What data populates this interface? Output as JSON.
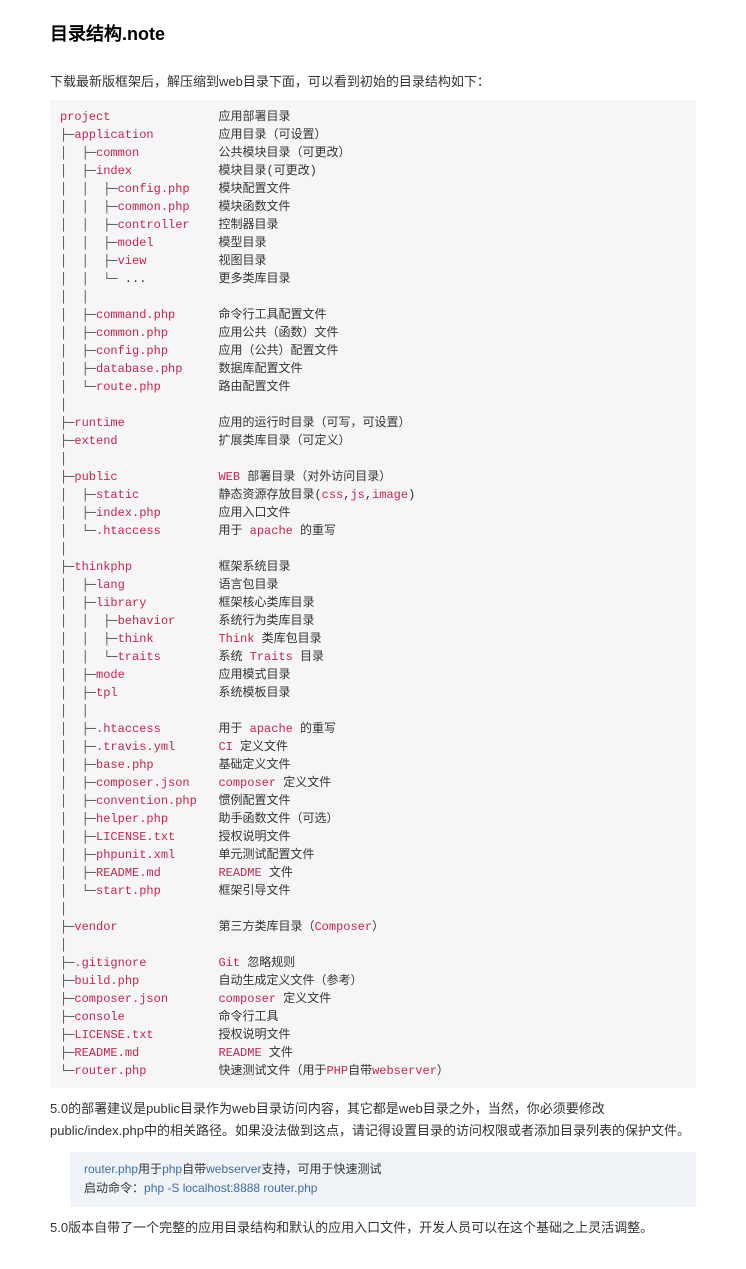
{
  "title": "目录结构.note",
  "intro": "下载最新版框架后，解压缩到web目录下面，可以看到初始的目录结构如下：",
  "tree": [
    {
      "pre": "",
      "name": "project",
      "desc": "应用部署目录",
      "emphName": true,
      "nameWidth": 10
    },
    {
      "pre": "├─",
      "name": "application",
      "desc": "应用目录（可设置）",
      "emphName": true
    },
    {
      "pre": "│  ├─",
      "name": "common",
      "desc": "公共模块目录（可更改）",
      "emphName": true
    },
    {
      "pre": "│  ├─",
      "name": "index",
      "desc": "模块目录(可更改)",
      "emphName": true
    },
    {
      "pre": "│  │  ├─",
      "name": "config.php",
      "desc": "模块配置文件",
      "emphName": true
    },
    {
      "pre": "│  │  ├─",
      "name": "common.php",
      "desc": "模块函数文件",
      "emphName": true
    },
    {
      "pre": "│  │  ├─",
      "name": "controller",
      "desc": "控制器目录",
      "emphName": true
    },
    {
      "pre": "│  │  ├─",
      "name": "model",
      "desc": "模型目录",
      "emphName": true
    },
    {
      "pre": "│  │  ├─",
      "name": "view",
      "desc": "视图目录",
      "emphName": true
    },
    {
      "pre": "│  │  └─",
      "name": " ...",
      "desc": "更多类库目录",
      "emphName": false
    },
    {
      "blank": true,
      "pre": "│  │"
    },
    {
      "pre": "│  ├─",
      "name": "command.php",
      "desc": "命令行工具配置文件",
      "emphName": true
    },
    {
      "pre": "│  ├─",
      "name": "common.php",
      "desc": "应用公共（函数）文件",
      "emphName": true
    },
    {
      "pre": "│  ├─",
      "name": "config.php",
      "desc": "应用（公共）配置文件",
      "emphName": true
    },
    {
      "pre": "│  ├─",
      "name": "database.php",
      "desc": "数据库配置文件",
      "emphName": true
    },
    {
      "pre": "│  └─",
      "name": "route.php",
      "desc": "路由配置文件",
      "emphName": true
    },
    {
      "blank": true,
      "pre": "│"
    },
    {
      "pre": "├─",
      "name": "runtime",
      "desc": "应用的运行时目录（可写，可设置）",
      "emphName": true
    },
    {
      "pre": "├─",
      "name": "extend",
      "desc": "扩展类库目录（可定义）",
      "emphName": true
    },
    {
      "blank": true,
      "pre": "│"
    },
    {
      "pre": "├─",
      "name": "public",
      "descParts": [
        {
          "t": "WEB",
          "e": true
        },
        {
          "t": " 部署目录（对外访问目录）",
          "e": false
        }
      ],
      "emphName": true
    },
    {
      "pre": "│  ├─",
      "name": "static",
      "descParts": [
        {
          "t": "静态资源存放目录(",
          "e": false
        },
        {
          "t": "css",
          "e": true
        },
        {
          "t": ",",
          "e": false
        },
        {
          "t": "js",
          "e": true
        },
        {
          "t": ",",
          "e": false
        },
        {
          "t": "image",
          "e": true
        },
        {
          "t": ")",
          "e": false
        }
      ],
      "emphName": true
    },
    {
      "pre": "│  ├─",
      "name": "index.php",
      "desc": "应用入口文件",
      "emphName": true
    },
    {
      "pre": "│  └─",
      "name": ".htaccess",
      "descParts": [
        {
          "t": "用于 ",
          "e": false
        },
        {
          "t": "apache",
          "e": true
        },
        {
          "t": " 的重写",
          "e": false
        }
      ],
      "emphName": true
    },
    {
      "blank": true,
      "pre": "│"
    },
    {
      "pre": "├─",
      "name": "thinkphp",
      "desc": "框架系统目录",
      "emphName": true
    },
    {
      "pre": "│  ├─",
      "name": "lang",
      "desc": "语言包目录",
      "emphName": true
    },
    {
      "pre": "│  ├─",
      "name": "library",
      "desc": "框架核心类库目录",
      "emphName": true
    },
    {
      "pre": "│  │  ├─",
      "name": "behavior",
      "desc": "系统行为类库目录",
      "emphName": true
    },
    {
      "pre": "│  │  ├─",
      "name": "think",
      "descParts": [
        {
          "t": "Think",
          "e": true
        },
        {
          "t": " 类库包目录",
          "e": false
        }
      ],
      "emphName": true
    },
    {
      "pre": "│  │  └─",
      "name": "traits",
      "descParts": [
        {
          "t": "系统 ",
          "e": false
        },
        {
          "t": "Traits",
          "e": true
        },
        {
          "t": " 目录",
          "e": false
        }
      ],
      "emphName": true
    },
    {
      "pre": "│  ├─",
      "name": "mode",
      "desc": "应用模式目录",
      "emphName": true
    },
    {
      "pre": "│  ├─",
      "name": "tpl",
      "desc": "系统模板目录",
      "emphName": true
    },
    {
      "blank": true,
      "pre": "│  │"
    },
    {
      "pre": "│  ├─",
      "name": ".htaccess",
      "descParts": [
        {
          "t": "用于 ",
          "e": false
        },
        {
          "t": "apache",
          "e": true
        },
        {
          "t": " 的重写",
          "e": false
        }
      ],
      "emphName": true
    },
    {
      "pre": "│  ├─",
      "name": ".travis.yml",
      "descParts": [
        {
          "t": "CI",
          "e": true
        },
        {
          "t": " 定义文件",
          "e": false
        }
      ],
      "emphName": true
    },
    {
      "pre": "│  ├─",
      "name": "base.php",
      "desc": "基础定义文件",
      "emphName": true
    },
    {
      "pre": "│  ├─",
      "name": "composer.json",
      "descParts": [
        {
          "t": "composer",
          "e": true
        },
        {
          "t": " 定义文件",
          "e": false
        }
      ],
      "emphName": true
    },
    {
      "pre": "│  ├─",
      "name": "convention.php",
      "desc": "惯例配置文件",
      "emphName": true
    },
    {
      "pre": "│  ├─",
      "name": "helper.php",
      "desc": "助手函数文件（可选）",
      "emphName": true
    },
    {
      "pre": "│  ├─",
      "name": "LICENSE.txt",
      "desc": "授权说明文件",
      "emphName": true
    },
    {
      "pre": "│  ├─",
      "name": "phpunit.xml",
      "desc": "单元测试配置文件",
      "emphName": true
    },
    {
      "pre": "│  ├─",
      "name": "README.md",
      "descParts": [
        {
          "t": "README",
          "e": true
        },
        {
          "t": " 文件",
          "e": false
        }
      ],
      "emphName": true
    },
    {
      "pre": "│  └─",
      "name": "start.php",
      "desc": "框架引导文件",
      "emphName": true
    },
    {
      "blank": true,
      "pre": "│"
    },
    {
      "pre": "├─",
      "name": "vendor",
      "descParts": [
        {
          "t": "第三方类库目录（",
          "e": false
        },
        {
          "t": "Composer",
          "e": true
        },
        {
          "t": "）",
          "e": false
        }
      ],
      "emphName": true
    },
    {
      "blank": true,
      "pre": "│"
    },
    {
      "pre": "├─",
      "name": ".gitignore",
      "descParts": [
        {
          "t": "Git",
          "e": true
        },
        {
          "t": " 忽略规则",
          "e": false
        }
      ],
      "emphName": true
    },
    {
      "pre": "├─",
      "name": "build.php",
      "desc": "自动生成定义文件（参考）",
      "emphName": true
    },
    {
      "pre": "├─",
      "name": "composer.json",
      "descParts": [
        {
          "t": "composer",
          "e": true
        },
        {
          "t": " 定义文件",
          "e": false
        }
      ],
      "emphName": true
    },
    {
      "pre": "├─",
      "name": "console",
      "desc": "命令行工具",
      "emphName": true
    },
    {
      "pre": "├─",
      "name": "LICENSE.txt",
      "desc": "授权说明文件",
      "emphName": true
    },
    {
      "pre": "├─",
      "name": "README.md",
      "descParts": [
        {
          "t": "README",
          "e": true
        },
        {
          "t": " 文件",
          "e": false
        }
      ],
      "emphName": true
    },
    {
      "pre": "└─",
      "name": "router.php",
      "descParts": [
        {
          "t": "快速测试文件（用于",
          "e": false
        },
        {
          "t": "PHP",
          "e": true
        },
        {
          "t": "自带",
          "e": false
        },
        {
          "t": "webserver",
          "e": true
        },
        {
          "t": "）",
          "e": false
        }
      ],
      "emphName": true
    }
  ],
  "para1": "5.0的部署建议是public目录作为web目录访问内容，其它都是web目录之外，当然，你必须要修改public/index.php中的相关路径。如果没法做到这点，请记得设置目录的访问权限或者添加目录列表的保护文件。",
  "callout": {
    "line1": [
      {
        "t": "router.php",
        "e": true
      },
      {
        "t": "用于",
        "e": false
      },
      {
        "t": "php",
        "e": true
      },
      {
        "t": "自带",
        "e": false
      },
      {
        "t": "webserver",
        "e": true
      },
      {
        "t": "支持，可用于快速测试",
        "e": false
      }
    ],
    "line2": [
      {
        "t": "启动命令：",
        "e": false
      },
      {
        "t": "php -S localhost:8888 router.php",
        "e": true
      }
    ]
  },
  "para2": "5.0版本自带了一个完整的应用目录结构和默认的应用入口文件，开发人员可以在这个基础之上灵活调整。"
}
